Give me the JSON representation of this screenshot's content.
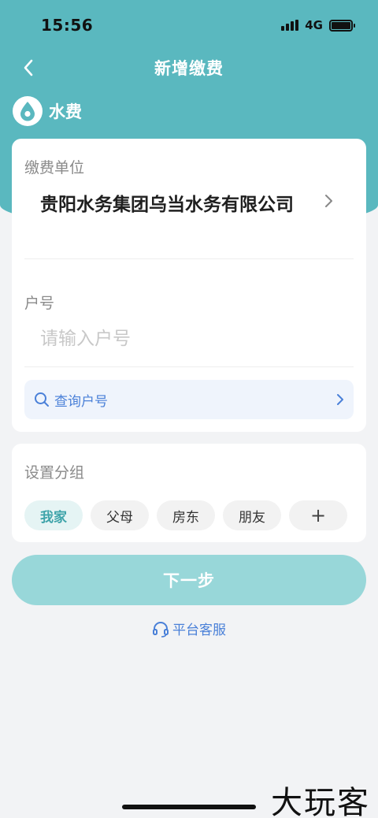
{
  "status": {
    "time": "15:56",
    "network": "4G"
  },
  "nav": {
    "title": "新增缴费"
  },
  "category": {
    "label": "水费",
    "icon": "water-drop-icon",
    "accent": "#5ab8bf"
  },
  "form": {
    "unit_label": "缴费单位",
    "unit_value": "贵阳水务集团乌当水务有限公司",
    "account_label": "户号",
    "account_placeholder": "请输入户号",
    "account_value": "",
    "query_label": "查询户号"
  },
  "group": {
    "label": "设置分组",
    "chips": [
      "我家",
      "父母",
      "房东",
      "朋友"
    ],
    "add_label": "+",
    "selected": "我家"
  },
  "actions": {
    "next_label": "下一步",
    "service_label": "平台客服"
  },
  "watermark": "大玩客",
  "colors": {
    "primary": "#5ab8bf",
    "button_disabled": "#98d7d9",
    "link": "#4a80d8"
  }
}
